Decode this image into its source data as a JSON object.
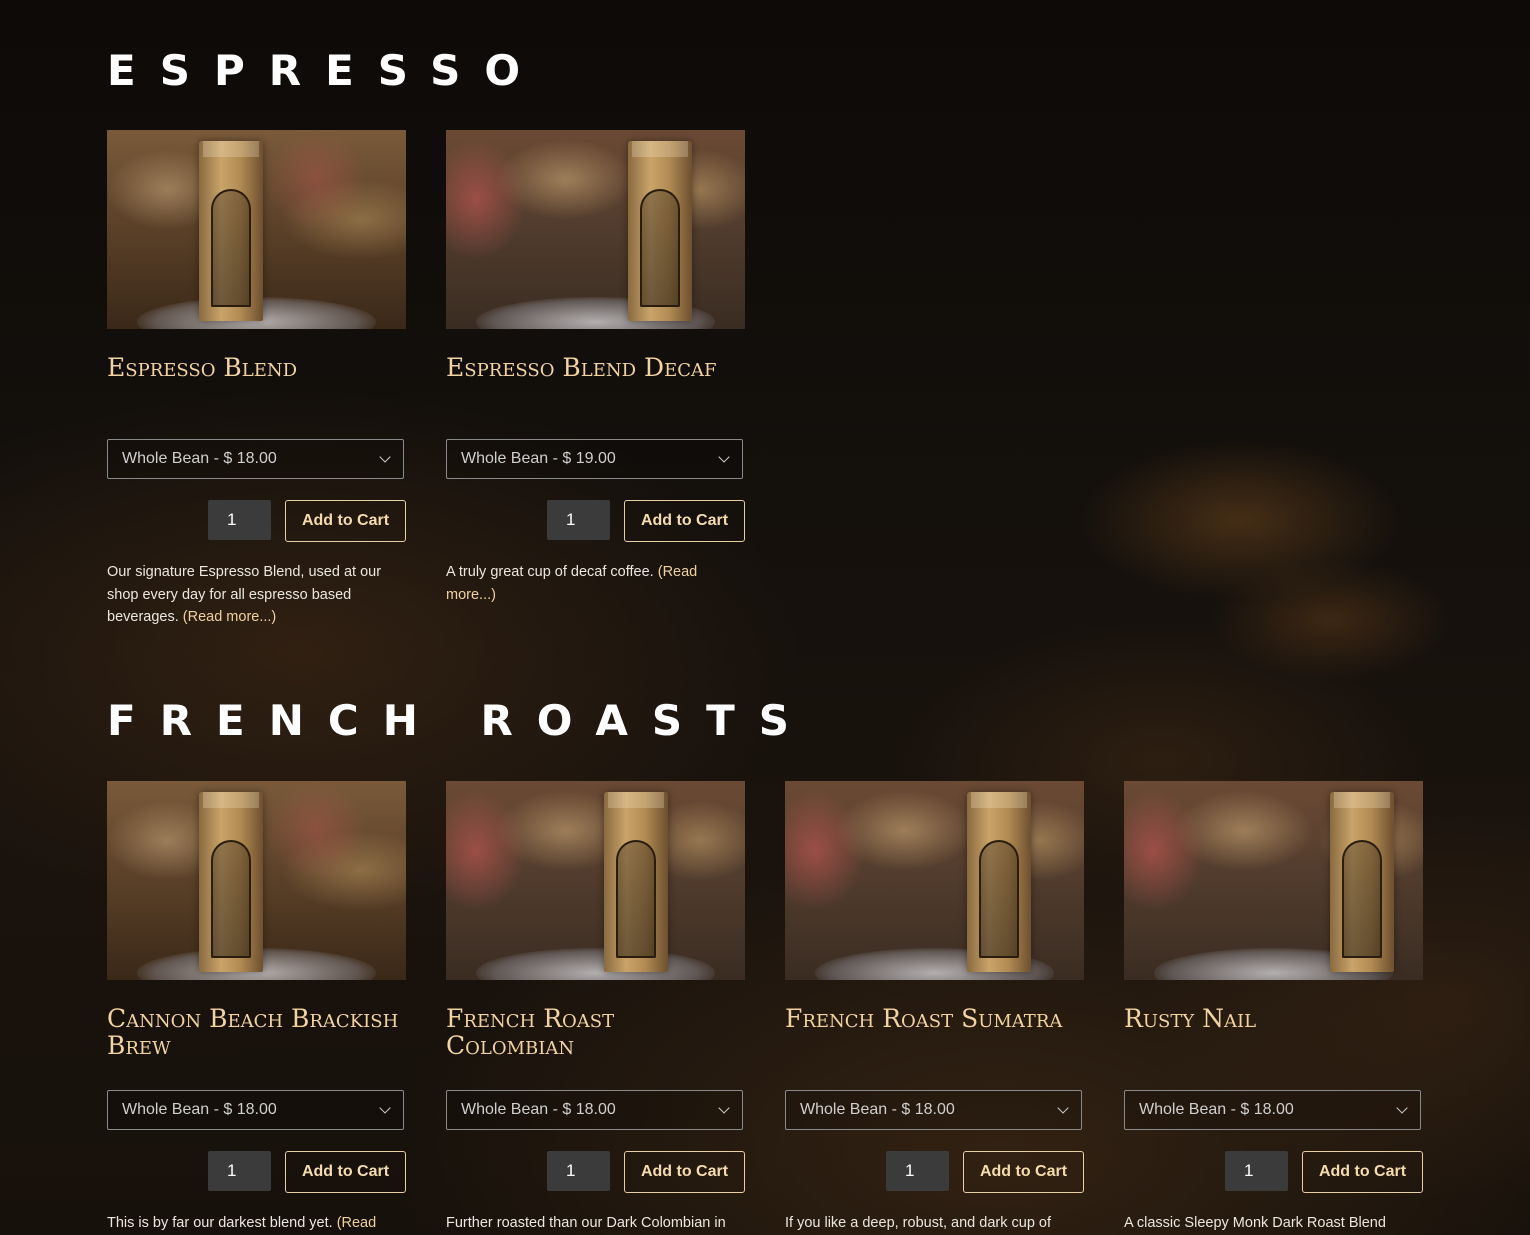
{
  "sections": [
    {
      "title": "ESPRESSO",
      "products": [
        {
          "name": "Espresso Blend",
          "variant": "Whole Bean - $ 18.00",
          "quantity": "1",
          "add_label": "Add to Cart",
          "description": "Our signature Espresso Blend, used at our shop every day for all espresso based beverages. ",
          "read_more": "(Read more...)"
        },
        {
          "name": "Espresso Blend Decaf",
          "variant": "Whole Bean - $ 19.00",
          "quantity": "1",
          "add_label": "Add to Cart",
          "description": "A truly great cup of decaf coffee. ",
          "read_more": "(Read more...)"
        }
      ]
    },
    {
      "title": "FRENCH ROASTS",
      "products": [
        {
          "name": "Cannon Beach Brackish Brew",
          "variant": "Whole Bean - $ 18.00",
          "quantity": "1",
          "add_label": "Add to Cart",
          "description": "This is by far our darkest blend yet.  ",
          "read_more": "(Read"
        },
        {
          "name": "French Roast Colombian",
          "variant": "Whole Bean - $ 18.00",
          "quantity": "1",
          "add_label": "Add to Cart",
          "description": "Further roasted than our Dark Colombian in",
          "read_more": ""
        },
        {
          "name": "French Roast Sumatra",
          "variant": "Whole Bean - $ 18.00",
          "quantity": "1",
          "add_label": "Add to Cart",
          "description": "If you like a deep, robust, and dark cup of",
          "read_more": ""
        },
        {
          "name": "Rusty Nail",
          "variant": "Whole Bean - $ 18.00",
          "quantity": "1",
          "add_label": "Add to Cart",
          "description": "A classic Sleepy Monk Dark Roast Blend",
          "read_more": ""
        }
      ]
    }
  ],
  "colors": {
    "heading": "#ffffff",
    "product_name": "#f2d3a2",
    "button_border": "#e7cfa6",
    "link": "#efd2a0"
  },
  "icons": {
    "select_arrow": "chevron-down-icon"
  }
}
